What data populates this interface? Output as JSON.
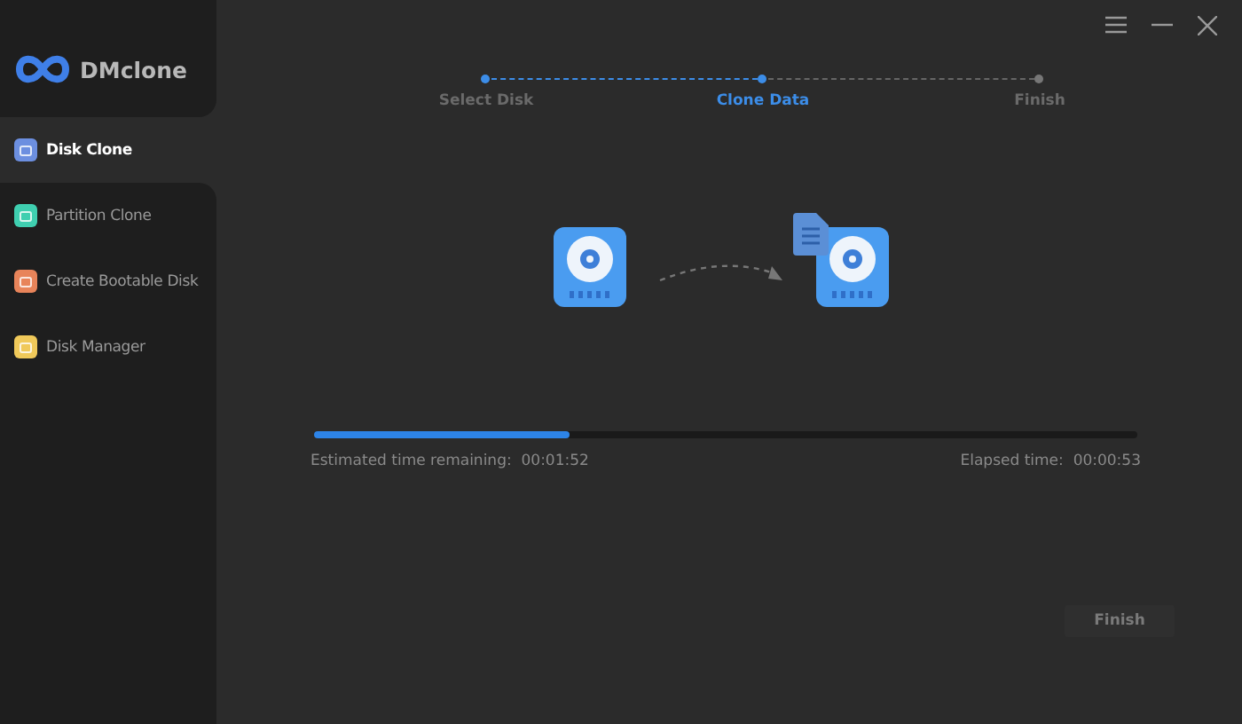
{
  "app": {
    "name": "DMclone"
  },
  "sidebar": {
    "items": [
      {
        "label": "Disk Clone",
        "selected": true,
        "color": "#6c8fe0"
      },
      {
        "label": "Partition Clone",
        "selected": false,
        "color": "#3fcfb0"
      },
      {
        "label": "Create Bootable Disk",
        "selected": false,
        "color": "#e8845a"
      },
      {
        "label": "Disk Manager",
        "selected": false,
        "color": "#f0c95a"
      }
    ]
  },
  "steps": [
    {
      "label": "Select Disk",
      "selected": false,
      "completed": true
    },
    {
      "label": "Clone Data",
      "selected": true,
      "completed": false
    },
    {
      "label": "Finish",
      "selected": false,
      "completed": false
    }
  ],
  "progress": {
    "level": 0.31
  },
  "estimated": {
    "label": "Estimated time remaining:",
    "value": "00:01:52"
  },
  "elapsed": {
    "label": "Elapsed time:",
    "value": "00:00:53"
  },
  "finish_button": {
    "label": "Finish",
    "disabled": true
  }
}
